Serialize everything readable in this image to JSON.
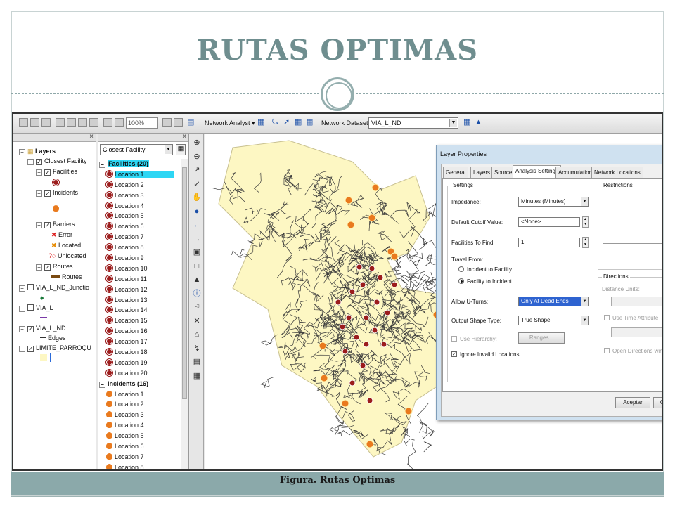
{
  "slide": {
    "title": "RUTAS OPTIMAS",
    "caption": "Figura. Rutas Optimas"
  },
  "toolbar": {
    "zoom_value": "100%",
    "network_analyst_label": "Network Analyst ▾",
    "network_dataset_label": "Network Dataset:",
    "network_dataset_value": "VIA_L_ND"
  },
  "toc": {
    "title": "Layers",
    "items": [
      {
        "label": "Closest Facility"
      },
      {
        "label": "Facilities"
      },
      {
        "label": "Incidents"
      },
      {
        "label": "Barriers"
      },
      {
        "label": "Error"
      },
      {
        "label": "Located"
      },
      {
        "label": "Unlocated"
      },
      {
        "label": "Routes"
      },
      {
        "label": "Routes"
      },
      {
        "label": "VIA_L_ND_Junctio"
      },
      {
        "label": "VIA_L"
      },
      {
        "label": "VIA_L_ND"
      },
      {
        "label": "Edges"
      },
      {
        "label": "LIMITE_PARROQU"
      }
    ]
  },
  "na_window": {
    "analysis_layer": "Closest Facility",
    "facilities_header": "Facilities (20)",
    "facilities": [
      "Location 1",
      "Location 2",
      "Location 3",
      "Location 4",
      "Location 5",
      "Location 6",
      "Location 7",
      "Location 8",
      "Location 9",
      "Location 10",
      "Location 11",
      "Location 12",
      "Location 13",
      "Location 14",
      "Location 15",
      "Location 16",
      "Location 17",
      "Location 18",
      "Location 19",
      "Location 20"
    ],
    "incidents_header": "Incidents (16)",
    "incidents": [
      "Location 1",
      "Location 2",
      "Location 3",
      "Location 4",
      "Location 5",
      "Location 6",
      "Location 7",
      "Location 8"
    ]
  },
  "tools": [
    "zoom-in-icon",
    "zoom-out-icon",
    "fixed-zoom-in-icon",
    "fixed-zoom-out-icon",
    "pan-icon",
    "globe-icon",
    "back-arrow-icon",
    "forward-arrow-icon",
    "select-features-icon",
    "clear-selection-icon",
    "pointer-icon",
    "identify-icon",
    "find-icon",
    "xy-icon",
    "measure-icon",
    "lightning-icon",
    "html-popup-icon",
    "time-slider-icon"
  ],
  "dialog": {
    "title": "Layer Properties",
    "tabs": [
      "General",
      "Layers",
      "Source",
      "Analysis Settings",
      "Accumulation",
      "Network Locations"
    ],
    "active_tab": "Analysis Settings",
    "settings_title": "Settings",
    "impedance_label": "Impedance:",
    "impedance_value": "Minutes (Minutes)",
    "cutoff_label": "Default Cutoff Value:",
    "cutoff_value": "<None>",
    "facilities_label": "Facilities To Find:",
    "facilities_value": "1",
    "travel_from_label": "Travel From:",
    "travel_option_1": "Incident to Facility",
    "travel_option_2": "Facility to Incident",
    "uturns_label": "Allow U-Turns:",
    "uturns_value": "Only At Dead Ends",
    "shape_label": "Output Shape Type:",
    "shape_value": "True Shape",
    "hierarchy_label": "Use Hierarchy:",
    "ranges_button": "Ranges...",
    "ignore_label": "Ignore Invalid Locations",
    "restrictions_title": "Restrictions",
    "directions_title": "Directions",
    "distance_units_label": "Distance Units:",
    "time_attr_label": "Use Time Attribute",
    "open_directions_label": "Open Directions windo",
    "accept_button": "Aceptar",
    "cancel_button": "Ca"
  },
  "colors": {
    "title": "#6f8e8f",
    "footer": "#8ba9aa",
    "map_area": "#fdf7c3",
    "road_network": "#3a3a3a",
    "facility_marker": "#9b1c1c",
    "incident_marker": "#e97a1e",
    "selection": "#2ed6f4"
  }
}
